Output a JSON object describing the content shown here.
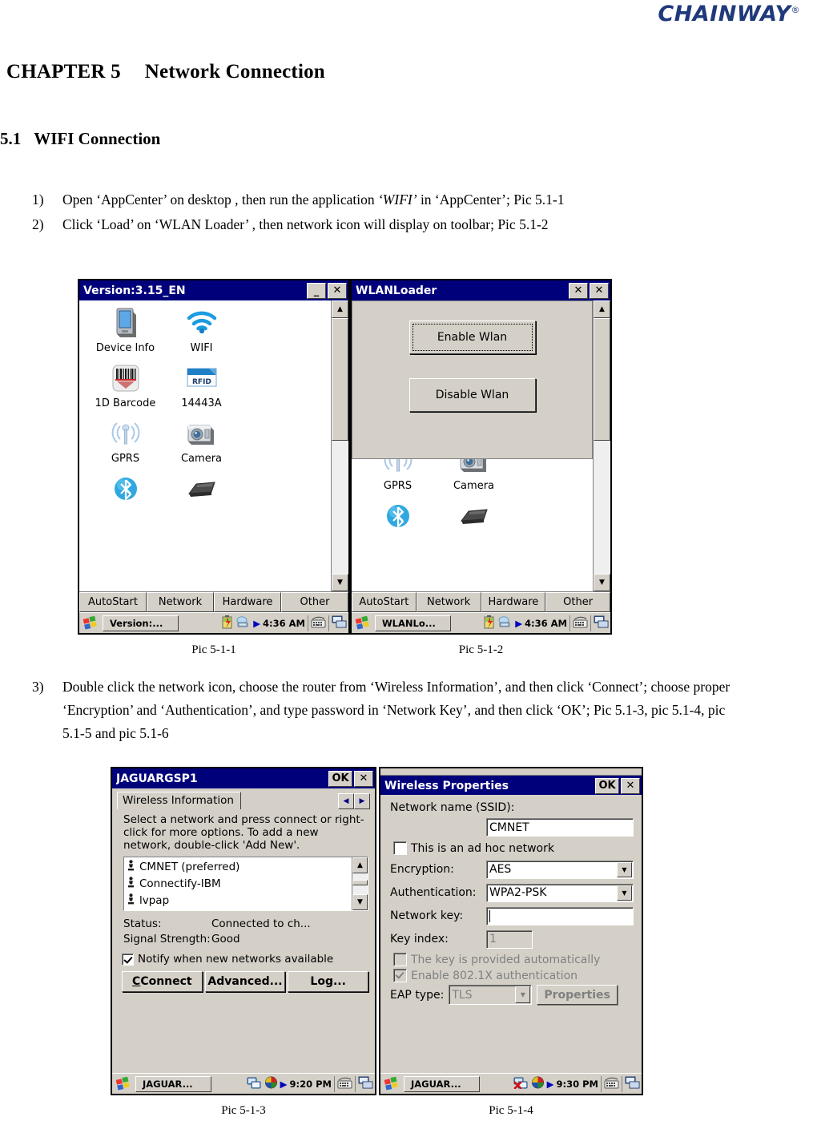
{
  "header": {
    "brand": "CHAINWAY",
    "brand_reg": "®"
  },
  "doc": {
    "chapter_num": "CHAPTER 5",
    "chapter_title": "Network Connection",
    "section_num": "5.1",
    "section_title": "WIFI Connection",
    "steps": [
      {
        "num": "1)",
        "pre": "Open ‘AppCenter’ on desktop , then run the application ",
        "em": "‘WIFI’",
        "post": " in ‘AppCenter’; Pic 5.1-1"
      },
      {
        "num": "2)",
        "pre": "Click ‘Load’ on ‘WLAN Loader’ , then network icon will display on toolbar; Pic 5.1-2",
        "em": "",
        "post": ""
      }
    ],
    "step3": {
      "num": "3)",
      "text": "Double click the network icon, choose the router from ‘Wireless Information’, and then click ‘Connect’; choose proper ‘Encryption’ and ‘Authentication’, and type password in ‘Network Key’, and then click ‘OK’; Pic 5.1-3, pic 5.1-4, pic 5.1-5 and pic 5.1-6"
    }
  },
  "captions": {
    "pic1": "Pic 5-1-1",
    "pic2": "Pic 5-1-2",
    "pic3": "Pic 5-1-3",
    "pic4": "Pic 5-1-4"
  },
  "shot1": {
    "title": "Version:3.15_EN",
    "buttons": {
      "minimize": "_",
      "close": "✕"
    },
    "icons": [
      {
        "label": "Device Info",
        "icon": "pda-device-icon"
      },
      {
        "label": "WIFI",
        "icon": "wifi-icon"
      },
      {
        "label": "1D Barcode",
        "icon": "barcode-icon"
      },
      {
        "label": "14443A",
        "icon": "rfid-icon"
      },
      {
        "label": "GPRS",
        "icon": "gprs-antenna-icon"
      },
      {
        "label": "Camera",
        "icon": "camera-icon"
      },
      {
        "label": "",
        "icon": "bluetooth-icon"
      },
      {
        "label": "",
        "icon": "scanner-icon"
      }
    ],
    "tabs": [
      "AutoStart",
      "Network",
      "Hardware",
      "Other"
    ],
    "taskbar": {
      "task": "Version:...",
      "time": "4:36 AM"
    }
  },
  "shot2": {
    "title": "WLANLoader",
    "buttons": {
      "close_inner": "✕",
      "close_outer": "✕"
    },
    "dialog_buttons": [
      "Enable Wlan",
      "Disable Wlan"
    ],
    "icons": [
      {
        "label": "GPRS",
        "icon": "gprs-antenna-icon"
      },
      {
        "label": "Camera",
        "icon": "camera-icon"
      },
      {
        "label": "",
        "icon": "bluetooth-icon"
      },
      {
        "label": "",
        "icon": "scanner-icon"
      }
    ],
    "tabs": [
      "AutoStart",
      "Network",
      "Hardware",
      "Other"
    ],
    "taskbar": {
      "task": "WLANLo...",
      "time": "4:36 AM"
    }
  },
  "shot3": {
    "title": "JAGUARGSP1",
    "buttons": {
      "ok": "OK",
      "close": "✕"
    },
    "tab_label": "Wireless Information",
    "help_text": "Select a network and press connect or right-click for more options.  To add a new network, double-click 'Add New'.",
    "networks": [
      "CMNET (preferred)",
      "Connectify-IBM",
      "lvpap"
    ],
    "status_label": "Status:",
    "status_value": "Connected to ch...",
    "signal_label": "Signal Strength:",
    "signal_value": "Good",
    "notify_label": "Notify when new networks available",
    "notify_checked": true,
    "action_buttons": [
      "Connect",
      "Advanced...",
      "Log..."
    ],
    "taskbar": {
      "task": "JAGUAR...",
      "time": "9:20 PM"
    }
  },
  "shot4": {
    "title": "Wireless Properties",
    "buttons": {
      "ok": "OK",
      "close": "✕"
    },
    "ssid_label": "Network name (SSID):",
    "ssid_value": "CMNET",
    "adhoc_label": "This is an ad hoc network",
    "adhoc_checked": false,
    "encryption_label": "Encryption:",
    "encryption_value": "AES",
    "auth_label": "Authentication:",
    "auth_value": "WPA2-PSK",
    "netkey_label": "Network key:",
    "netkey_value": "",
    "keyindex_label": "Key index:",
    "keyindex_value": "1",
    "autokey_label": "The key is provided automatically",
    "autokey_checked": false,
    "dot1x_label": "Enable 802.1X authentication",
    "dot1x_checked": true,
    "eap_label": "EAP type:",
    "eap_value": "TLS",
    "properties_label": "Properties",
    "taskbar": {
      "task": "JAGUAR...",
      "time": "9:30 PM"
    }
  },
  "colors": {
    "brand_blue": "#1F3A7A",
    "titlebar_blue": "#00007b",
    "chrome_gray": "#d4d0c8"
  }
}
